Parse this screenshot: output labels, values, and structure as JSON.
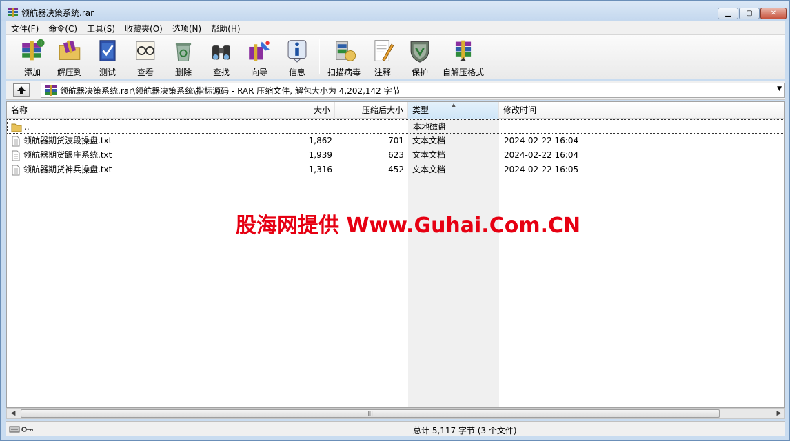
{
  "window": {
    "title": "领航器决策系统.rar"
  },
  "menu": [
    "文件(F)",
    "命令(C)",
    "工具(S)",
    "收藏夹(O)",
    "选项(N)",
    "帮助(H)"
  ],
  "toolbar": {
    "add": "添加",
    "extract_to": "解压到",
    "test": "测试",
    "view": "查看",
    "delete": "删除",
    "find": "查找",
    "wizard": "向导",
    "info": "信息",
    "virus_scan": "扫描病毒",
    "comment": "注释",
    "protect": "保护",
    "sfx": "自解压格式"
  },
  "address": {
    "path": "领航器决策系统.rar\\领航器决策系统\\指标源码 - RAR 压缩文件, 解包大小为 4,202,142 字节"
  },
  "columns": {
    "name": "名称",
    "size": "大小",
    "packed": "压缩后大小",
    "type": "类型",
    "modified": "修改时间"
  },
  "files": [
    {
      "name": "..",
      "size": "",
      "packed": "",
      "type": "本地磁盘",
      "modified": ""
    },
    {
      "name": "领航器期货波段操盘.txt",
      "size": "1,862",
      "packed": "701",
      "type": "文本文档",
      "modified": "2024-02-22 16:04"
    },
    {
      "name": "领航器期货跟庄系统.txt",
      "size": "1,939",
      "packed": "623",
      "type": "文本文档",
      "modified": "2024-02-22 16:04"
    },
    {
      "name": "领航器期货神兵操盘.txt",
      "size": "1,316",
      "packed": "452",
      "type": "文本文档",
      "modified": "2024-02-22 16:05"
    }
  ],
  "watermark": "股海网提供 Www.Guhai.Com.CN",
  "status": {
    "total": "总计 5,117 字节 (3 个文件)"
  },
  "colors": {
    "watermark": "#e60012",
    "sorted_column": "#f0f0f0"
  }
}
